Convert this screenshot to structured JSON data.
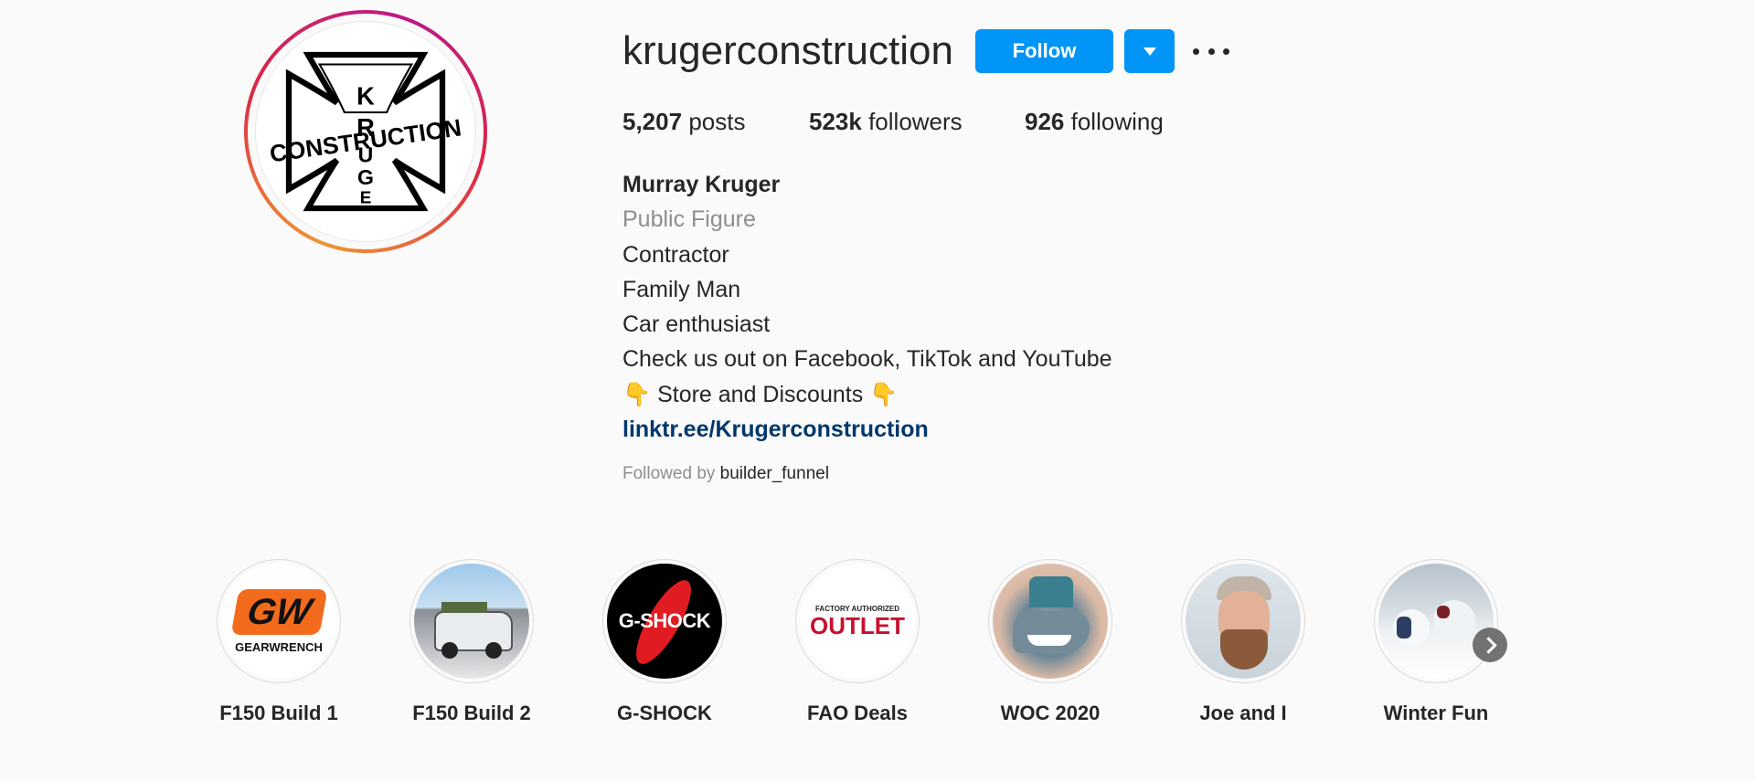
{
  "profile": {
    "username": "krugerconstruction",
    "follow_label": "Follow",
    "stats": {
      "posts_count": "5,207",
      "posts_label": "posts",
      "followers_count": "523k",
      "followers_label": "followers",
      "following_count": "926",
      "following_label": "following"
    },
    "bio": {
      "name": "Murray Kruger",
      "category": "Public Figure",
      "lines": [
        "Contractor",
        "Family Man",
        "Car enthusiast",
        "Check us out on Facebook, TikTok and YouTube",
        "👇 Store and Discounts 👇"
      ],
      "link": "linktr.ee/Krugerconstruction"
    },
    "followed_by_prefix": "Followed by",
    "followed_by_user": "builder_funnel",
    "avatar_logo": {
      "top_text": "KRUGER",
      "side_text": "CONSTRUCTION"
    }
  },
  "highlights": [
    {
      "label": "F150 Build 1",
      "thumb_text": "GW",
      "thumb_subtext": "GEARWRENCH"
    },
    {
      "label": "F150 Build 2"
    },
    {
      "label": "G-SHOCK",
      "thumb_text": "G-SHOCK"
    },
    {
      "label": "FAO Deals",
      "thumb_subtext": "FACTORY AUTHORIZED",
      "thumb_text": "OUTLET"
    },
    {
      "label": "WOC 2020"
    },
    {
      "label": "Joe and I"
    },
    {
      "label": "Winter Fun"
    }
  ],
  "colors": {
    "follow_blue": "#0095f6",
    "link_blue": "#00376b",
    "muted_gray": "#8e8e8e",
    "text": "#262626"
  }
}
